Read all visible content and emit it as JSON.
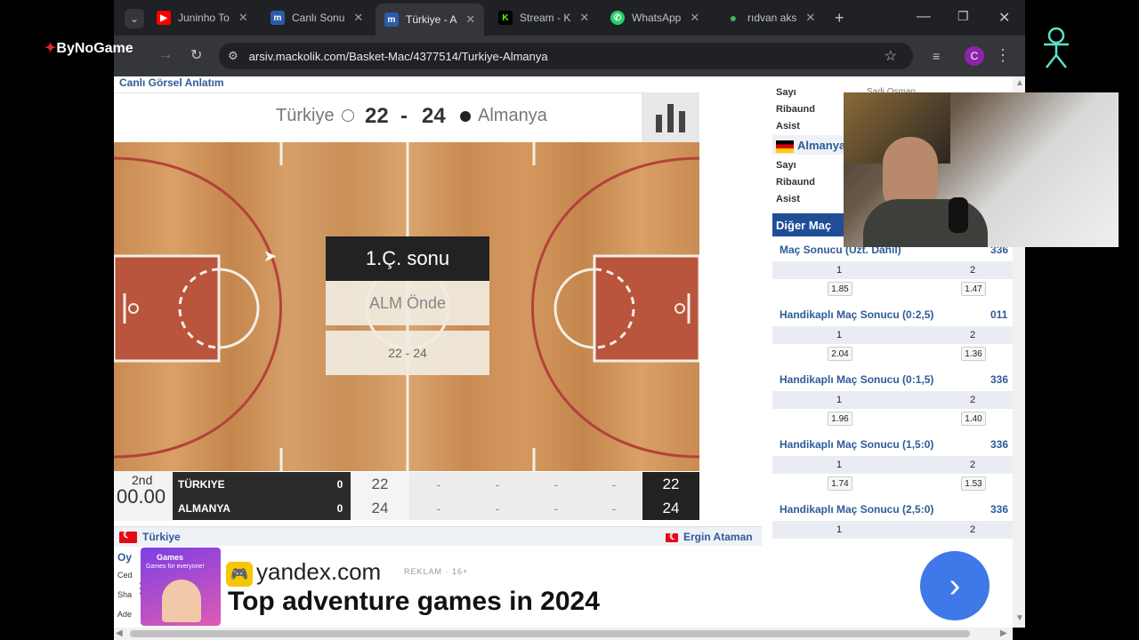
{
  "browser": {
    "tabs": [
      {
        "label": "Juninho To",
        "icon": "youtube-icon",
        "color": "#ff0000"
      },
      {
        "label": "Canlı Sonu",
        "icon": "mackolik-icon",
        "color": "#2a5ca8"
      },
      {
        "label": "Türkiye - A",
        "icon": "mackolik-icon",
        "color": "#2a5ca8",
        "active": true
      },
      {
        "label": "Stream - K",
        "icon": "kick-icon",
        "color": "#53fc18"
      },
      {
        "label": "WhatsApp",
        "icon": "whatsapp-icon",
        "color": "#25d366"
      },
      {
        "label": "rıdvan aks",
        "icon": "drop-icon",
        "color": "#4caf50"
      }
    ],
    "url": "arsiv.mackolik.com/Basket-Mac/4377514/Turkiye-Almanya",
    "profile_initial": "C"
  },
  "game": {
    "section_title": "Canlı Görsel Anlatım",
    "home_team": "Türkiye",
    "away_team": "Almanya",
    "home_score": "22",
    "away_score": "24",
    "score_sep": "-",
    "overlay": {
      "title": "1.Ç. sonu",
      "lead": "ALM Önde",
      "score": "22 - 24"
    },
    "period": "2nd",
    "clock": "00.00",
    "scoreboard": [
      {
        "team": "TÜRKIYE",
        "fouls": "0",
        "q1": "22",
        "q2": "-",
        "q3": "-",
        "q4": "-",
        "ot": "-",
        "total": "22"
      },
      {
        "team": "ALMANYA",
        "fouls": "0",
        "q1": "24",
        "q2": "-",
        "q3": "-",
        "q4": "-",
        "ot": "-",
        "total": "24"
      }
    ],
    "team_strip_left": "Türkiye",
    "team_strip_right": "Ergin Ataman",
    "side_tab": "Oy",
    "side_rows": [
      "Ced",
      "Sha",
      "Ade"
    ]
  },
  "stats": {
    "home_labels": [
      "Sayı",
      "Ribaund",
      "Asist"
    ],
    "home_player": "Sadi Osman",
    "away_team": "Almanya",
    "away_labels": [
      "Sayı",
      "Ribaund",
      "Asist"
    ]
  },
  "markets": {
    "header": "Diğer Maç",
    "items": [
      {
        "title": "Maç Sonucu (Uzt. Dahil)",
        "id": "336",
        "o1": "1.85",
        "o2": "1.47"
      },
      {
        "title": "Handikaplı Maç Sonucu (0:2,5)",
        "id": "011",
        "o1": "2.04",
        "o2": "1.36"
      },
      {
        "title": "Handikaplı Maç Sonucu (0:1,5)",
        "id": "336",
        "o1": "1.96",
        "o2": "1.40"
      },
      {
        "title": "Handikaplı Maç Sonucu (1,5:0)",
        "id": "336",
        "o1": "1.74",
        "o2": "1.53"
      },
      {
        "title": "Handikaplı Maç Sonucu (2,5:0)",
        "id": "336",
        "o1": "",
        "o2": ""
      }
    ],
    "col1": "1",
    "col2": "2",
    "trailing_id": "336"
  },
  "ad": {
    "thumb_badge": "Games",
    "thumb_sub": "Games for everyone!",
    "domain": "yandex.com",
    "reklam": "REKLAM · 16+",
    "headline": "Top adventure games in 2024"
  },
  "overlay_brand": "ByNoGame"
}
